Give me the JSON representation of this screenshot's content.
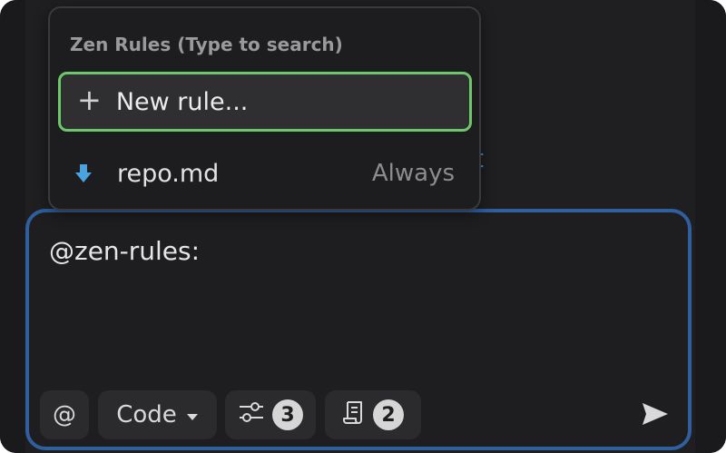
{
  "background": {
    "partial_text": "t",
    "link_color": "#3a8fd6"
  },
  "popup": {
    "title": "Zen Rules (Type to search)",
    "new_rule_label": "New rule...",
    "new_rule_icon": "plus-icon",
    "highlight_color": "#6cc86a",
    "items": [
      {
        "name": "repo.md",
        "mode": "Always",
        "icon": "download-arrow-icon",
        "icon_color": "#4aa3df"
      }
    ]
  },
  "chat": {
    "input_text": "@zen-rules:",
    "border_color": "#2f5f9e",
    "toolbar": {
      "mention_label": "@",
      "mode_label": "Code",
      "settings_count": "3",
      "rules_count": "2"
    }
  }
}
